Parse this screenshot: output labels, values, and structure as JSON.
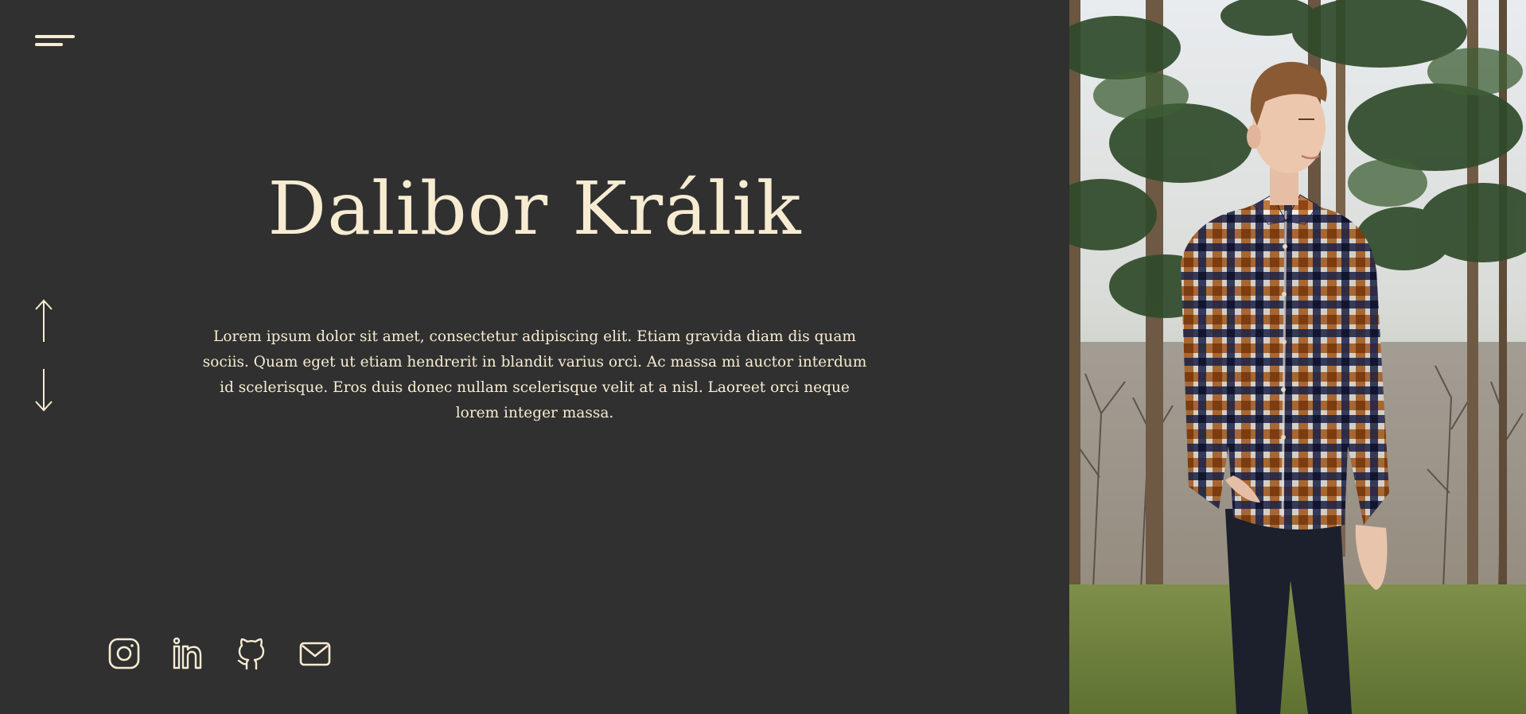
{
  "header": {
    "name": "Dalibor Králik"
  },
  "intro": {
    "text": "Lorem ipsum dolor sit amet, consectetur adipiscing elit. Etiam gravida diam dis quam sociis. Quam eget ut etiam hendrerit in blandit varius orci. Ac massa mi auctor interdum id scelerisque. Eros duis donec nullam scelerisque velit at a nisl. Laoreet orci neque lorem integer massa."
  },
  "navigation": {
    "menu_icon": "hamburger-menu-icon",
    "up_icon": "arrow-up-icon",
    "down_icon": "arrow-down-icon"
  },
  "social": [
    {
      "icon": "instagram-icon"
    },
    {
      "icon": "linkedin-icon"
    },
    {
      "icon": "github-icon"
    },
    {
      "icon": "mail-icon"
    }
  ],
  "colors": {
    "background": "#303030",
    "accent": "#f7ecd2"
  }
}
